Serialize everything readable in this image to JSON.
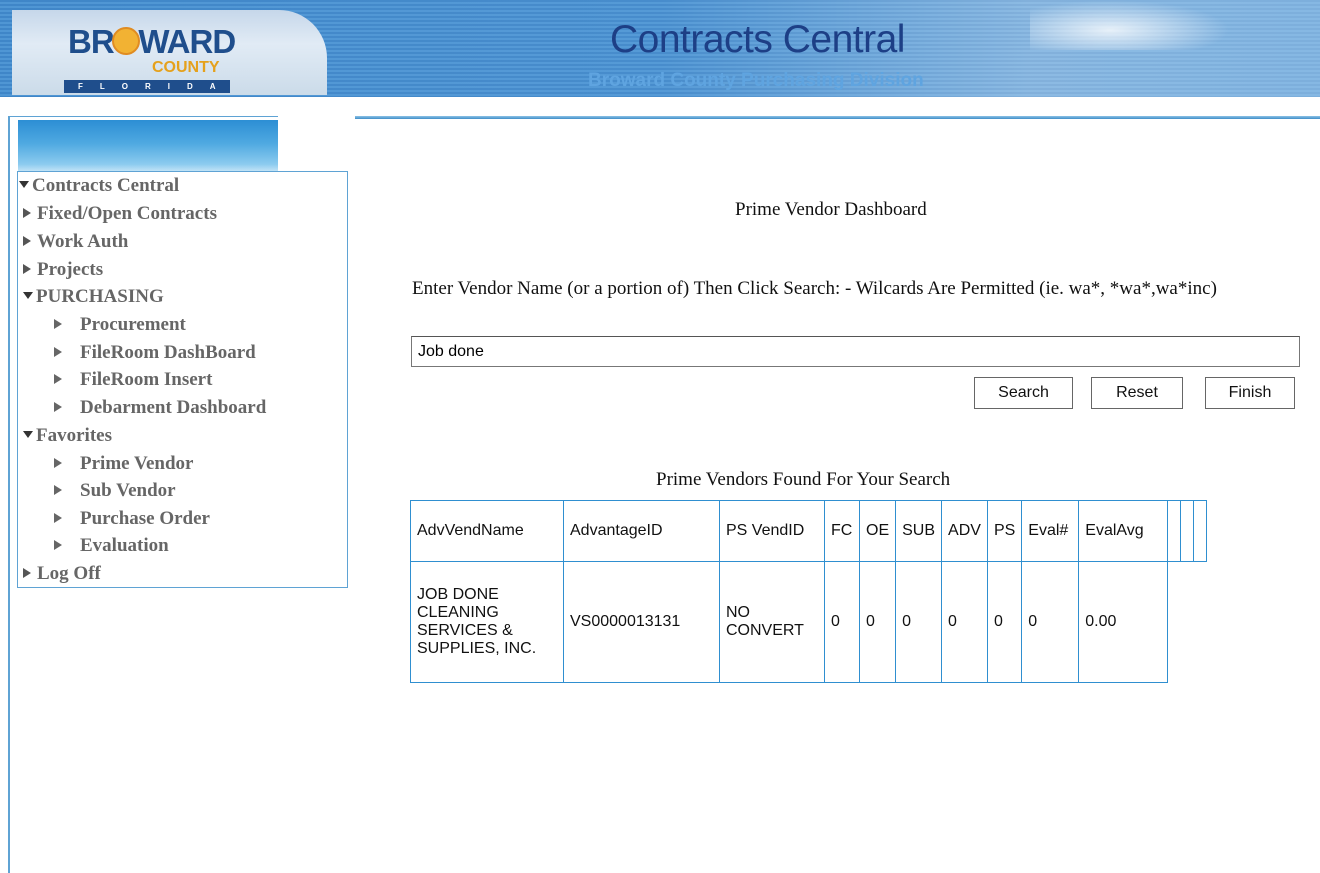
{
  "header": {
    "logo": {
      "word": "BROWARD",
      "county": "COUNTY",
      "state": "FLORIDA"
    },
    "title": "Contracts Central",
    "subtitle": "Broward County Purchasing Division"
  },
  "sidebar": {
    "items": [
      {
        "label": "Contracts Central",
        "expanded": true,
        "level": 0
      },
      {
        "label": "Fixed/Open Contracts",
        "level": 1
      },
      {
        "label": "Work Auth",
        "level": 1
      },
      {
        "label": "Projects",
        "level": 1
      },
      {
        "label": "PURCHASING",
        "expanded": true,
        "level": 1
      },
      {
        "label": "Procurement",
        "level": 2
      },
      {
        "label": "FileRoom DashBoard",
        "level": 2
      },
      {
        "label": "FileRoom Insert",
        "level": 2
      },
      {
        "label": "Debarment Dashboard",
        "level": 2
      },
      {
        "label": "Favorites",
        "expanded": true,
        "level": 1
      },
      {
        "label": "Prime Vendor",
        "level": 2
      },
      {
        "label": "Sub Vendor",
        "level": 2
      },
      {
        "label": "Purchase Order",
        "level": 2
      },
      {
        "label": "Evaluation",
        "level": 2
      },
      {
        "label": "Log Off",
        "level": 1
      }
    ]
  },
  "main": {
    "page_title": "Prime Vendor Dashboard",
    "instructions": "Enter Vendor Name (or a portion of) Then Click Search: - Wilcards Are Permitted (ie. wa*, *wa*,wa*inc)",
    "search": {
      "value": "Job done"
    },
    "buttons": {
      "search": "Search",
      "reset": "Reset",
      "finish": "Finish"
    },
    "results_caption": "Prime Vendors Found For Your Search",
    "table": {
      "headers": [
        "AdvVendName",
        "AdvantageID",
        "PS VendID",
        "FC",
        "OE",
        "SUB",
        "ADV",
        "PS",
        "Eval#",
        "EvalAvg"
      ],
      "rows": [
        [
          "JOB DONE CLEANING SERVICES & SUPPLIES, INC.",
          "VS0000013131",
          "NO CONVERT",
          "0",
          "0",
          "0",
          "0",
          "0",
          "0",
          "0.00"
        ]
      ]
    }
  },
  "colors": {
    "banner_blue": "#3f86c8",
    "title_navy": "#1d3f86",
    "subtitle_blue": "#5fa4e0",
    "table_border": "#2f8fd0"
  }
}
